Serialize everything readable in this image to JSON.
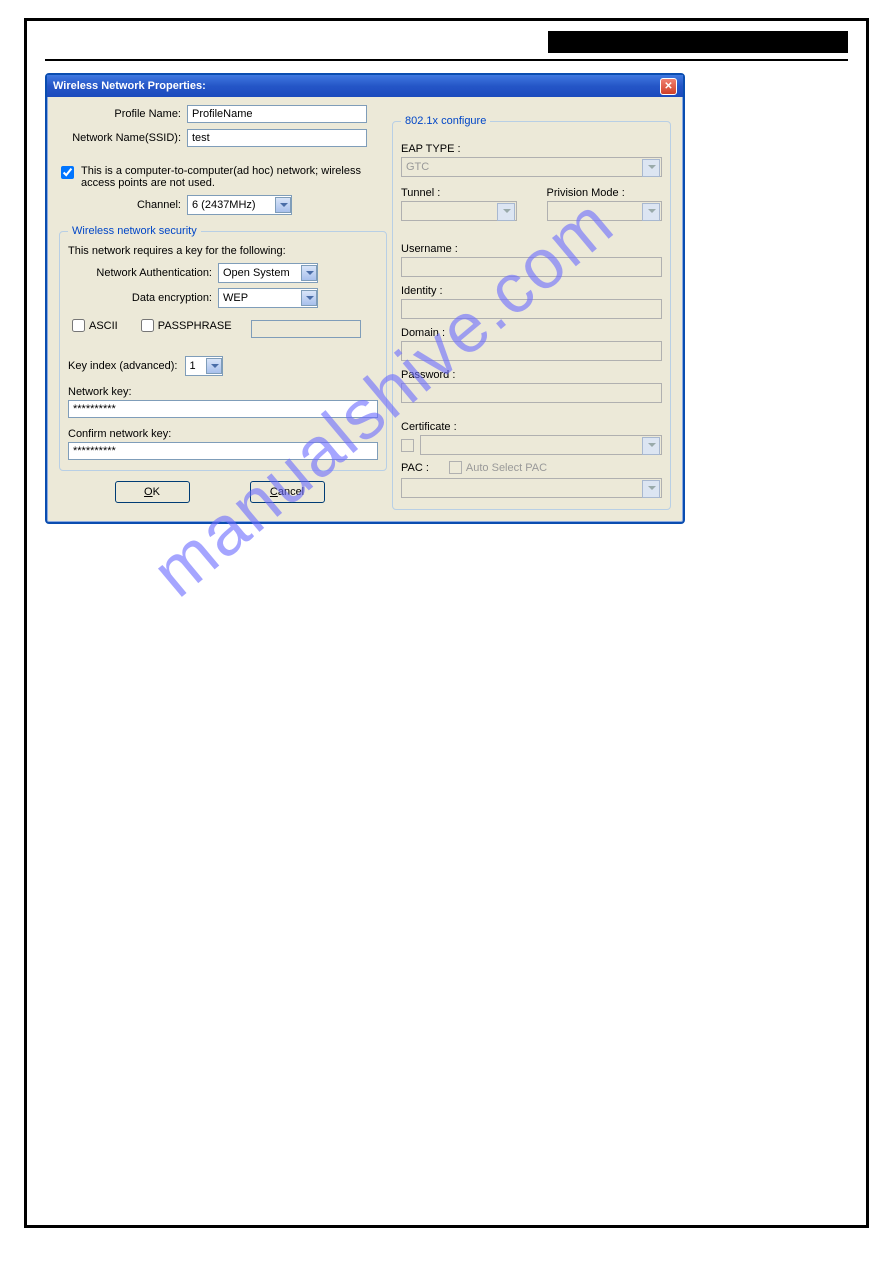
{
  "window": {
    "title": "Wireless Network Properties:"
  },
  "left": {
    "profile_name_label": "Profile Name:",
    "profile_name_value": "ProfileName",
    "ssid_label": "Network Name(SSID):",
    "ssid_value": "test",
    "adhoc_label": "This is a computer-to-computer(ad hoc) network; wireless access points are not used.",
    "adhoc_checked": true,
    "channel_label": "Channel:",
    "channel_value": "6  (2437MHz)",
    "security_legend": "Wireless network security",
    "security_desc": "This network requires a key for the following:",
    "auth_label": "Network Authentication:",
    "auth_value": "Open System",
    "enc_label": "Data encryption:",
    "enc_value": "WEP",
    "ascii_label": "ASCII",
    "passphrase_label": "PASSPHRASE",
    "keyindex_label": "Key index (advanced):",
    "keyindex_value": "1",
    "netkey_label": "Network key:",
    "netkey_value": "**********",
    "confirm_label": "Confirm network key:",
    "confirm_value": "**********",
    "ok_label": "OK",
    "cancel_label": "Cancel"
  },
  "right": {
    "legend": "802.1x configure",
    "eap_label": "EAP TYPE :",
    "eap_value": "GTC",
    "tunnel_label": "Tunnel :",
    "privmode_label": "Privision Mode :",
    "username_label": "Username :",
    "identity_label": "Identity :",
    "domain_label": "Domain :",
    "password_label": "Password :",
    "certificate_label": "Certificate :",
    "pac_label": "PAC :",
    "autopac_label": "Auto Select PAC"
  },
  "watermark": "manualshive.com"
}
